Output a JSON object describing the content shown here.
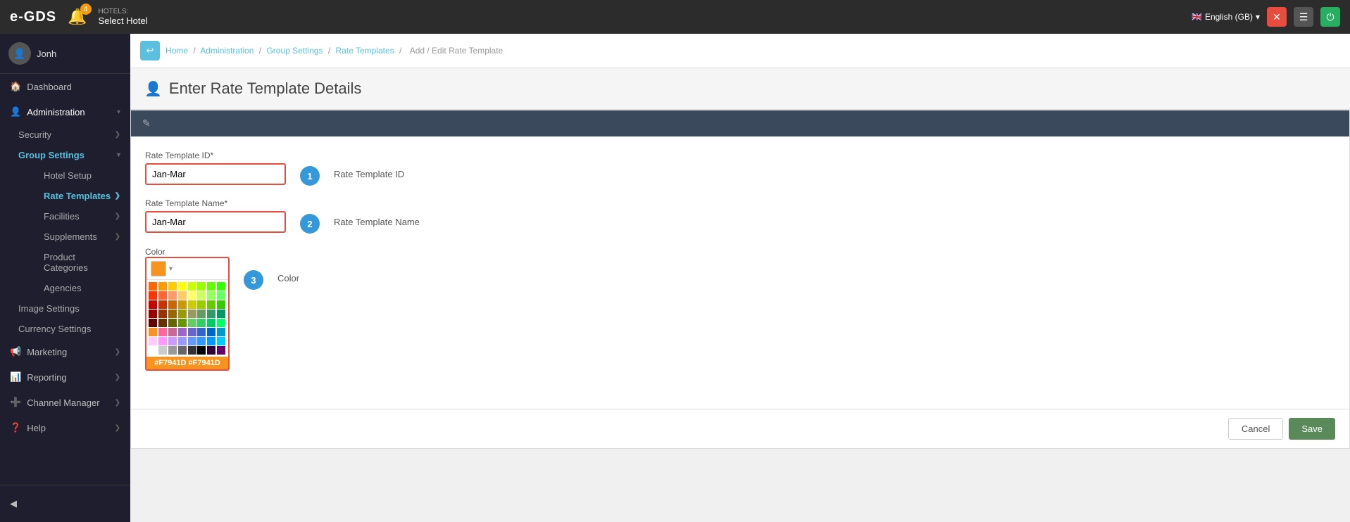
{
  "app": {
    "logo": "e-GDS",
    "hotel_label": "HOTELS:",
    "hotel_name": "Select Hotel",
    "language": "English (GB)",
    "notification_count": "4"
  },
  "sidebar": {
    "username": "Jonh",
    "items": [
      {
        "id": "dashboard",
        "label": "Dashboard",
        "icon": "🏠"
      },
      {
        "id": "administration",
        "label": "Administration",
        "icon": "👤",
        "expanded": true
      },
      {
        "id": "security",
        "label": "Security",
        "sub": true
      },
      {
        "id": "group-settings",
        "label": "Group Settings",
        "sub": true,
        "expanded": true
      },
      {
        "id": "hotel-setup",
        "label": "Hotel Setup",
        "subsub": true
      },
      {
        "id": "rate-templates",
        "label": "Rate Templates",
        "subsub": true,
        "active": true
      },
      {
        "id": "facilities",
        "label": "Facilities",
        "subsub": true
      },
      {
        "id": "supplements",
        "label": "Supplements",
        "subsub": true
      },
      {
        "id": "product-categories",
        "label": "Product Categories",
        "subsub": true
      },
      {
        "id": "agencies",
        "label": "Agencies",
        "subsub": true
      },
      {
        "id": "image-settings",
        "label": "Image Settings",
        "sub": true
      },
      {
        "id": "currency-settings",
        "label": "Currency Settings",
        "sub": true
      },
      {
        "id": "marketing",
        "label": "Marketing",
        "icon": "📢"
      },
      {
        "id": "reporting",
        "label": "Reporting",
        "icon": "📊"
      },
      {
        "id": "channel-manager",
        "label": "Channel Manager",
        "icon": "➕"
      },
      {
        "id": "help",
        "label": "Help",
        "icon": "❓"
      }
    ]
  },
  "breadcrumb": {
    "items": [
      "Home",
      "Administration",
      "Group Settings",
      "Rate Templates",
      "Add / Edit Rate Template"
    ]
  },
  "page": {
    "title": "Enter Rate Template Details",
    "icon": "👤"
  },
  "form": {
    "rate_template_id_label": "Rate Template ID*",
    "rate_template_id_value": "Jan-Mar",
    "rate_template_name_label": "Rate Template Name*",
    "rate_template_name_value": "Jan-Mar",
    "color_label": "Color",
    "color_hex": "#F7941D",
    "color_hex_display": "#F7941D #F7941D",
    "step1_label": "Rate Template ID",
    "step2_label": "Rate Template Name",
    "step3_label": "Color"
  },
  "buttons": {
    "cancel": "Cancel",
    "save": "Save"
  },
  "colors": [
    "#FF6600",
    "#FF9900",
    "#FFCC00",
    "#FFFF00",
    "#CCFF00",
    "#99FF00",
    "#66FF00",
    "#33FF00",
    "#FF3300",
    "#FF6633",
    "#FF9966",
    "#FFCC66",
    "#FFFF66",
    "#CCFF66",
    "#99FF66",
    "#66FF66",
    "#CC0000",
    "#CC3300",
    "#CC6600",
    "#CC9900",
    "#CCCC00",
    "#99CC00",
    "#66CC00",
    "#33CC00",
    "#990000",
    "#993300",
    "#996600",
    "#999900",
    "#999966",
    "#669966",
    "#339966",
    "#009966",
    "#660000",
    "#663300",
    "#666600",
    "#669900",
    "#66CC66",
    "#33CC66",
    "#00CC66",
    "#00FF66",
    "#F7941D",
    "#FF6699",
    "#CC6699",
    "#9966CC",
    "#6666CC",
    "#3366CC",
    "#0066CC",
    "#0099CC",
    "#FFCCFF",
    "#FF99FF",
    "#CC99FF",
    "#9999FF",
    "#6699FF",
    "#3399FF",
    "#0099FF",
    "#00CCFF",
    "#FFFFFF",
    "#CCCCCC",
    "#999999",
    "#666666",
    "#333333",
    "#000000",
    "#330033",
    "#660066"
  ]
}
